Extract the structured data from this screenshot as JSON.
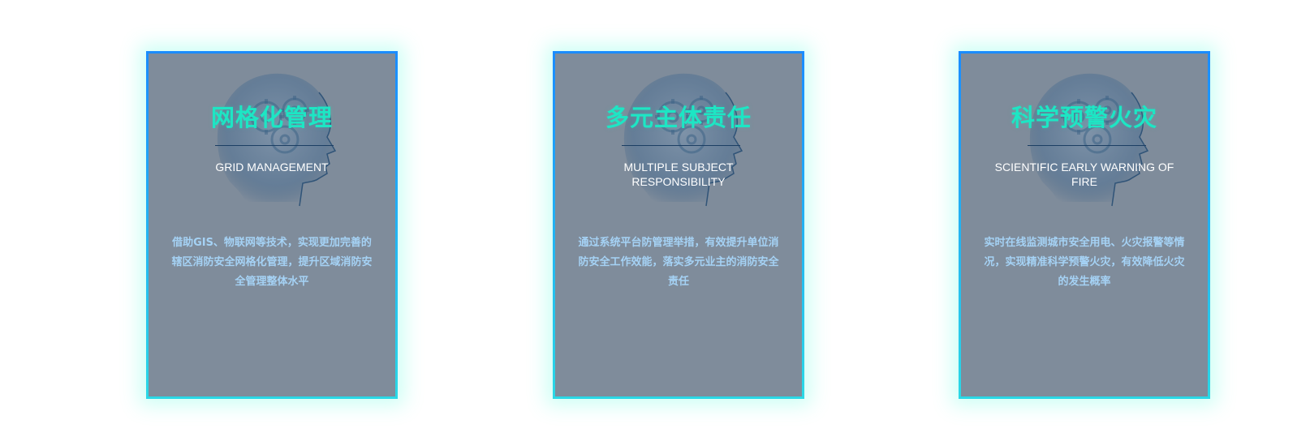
{
  "cards": [
    {
      "title": "网格化管理",
      "subtitle": "GRID MANAGEMENT",
      "description": "借助GIS、物联网等技术，实现更加完善的辖区消防安全网格化管理，提升区域消防安全管理整体水平"
    },
    {
      "title": "多元主体责任",
      "subtitle": "MULTIPLE SUBJECT RESPONSIBILITY",
      "description": "通过系统平台防管理举措，有效提升单位消防安全工作效能，落实多元业主的消防安全责任"
    },
    {
      "title": "科学预警火灾",
      "subtitle": "SCIENTIFIC EARLY WARNING OF FIRE",
      "description": "实时在线监测城市安全用电、火灾报警等情况，实现精准科学预警火灾，有效降低火灾的发生概率"
    }
  ],
  "colors": {
    "card_bg": "#7f8c9b",
    "title": "#1de6c4",
    "description": "#a5d2f5",
    "border_top": "#1a8cff",
    "border_bottom": "#2ad8e6",
    "glow": "#50ffdc"
  },
  "icons": [
    "head-gears-icon"
  ]
}
